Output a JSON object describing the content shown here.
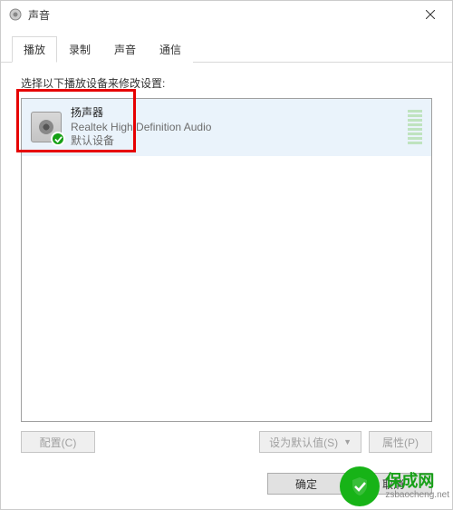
{
  "window": {
    "title": "声音"
  },
  "tabs": [
    {
      "label": "播放",
      "active": true
    },
    {
      "label": "录制",
      "active": false
    },
    {
      "label": "声音",
      "active": false
    },
    {
      "label": "通信",
      "active": false
    }
  ],
  "prompt": "选择以下播放设备来修改设置:",
  "devices": [
    {
      "name": "扬声器",
      "driver": "Realtek High Definition Audio",
      "status": "默认设备",
      "default": true
    }
  ],
  "buttons": {
    "configure": "配置(C)",
    "set_default": "设为默认值(S)",
    "properties": "属性(P)",
    "ok": "确定",
    "cancel": "取消"
  },
  "watermark": {
    "name_cn": "保成网",
    "url": "zsbaocheng.net"
  }
}
